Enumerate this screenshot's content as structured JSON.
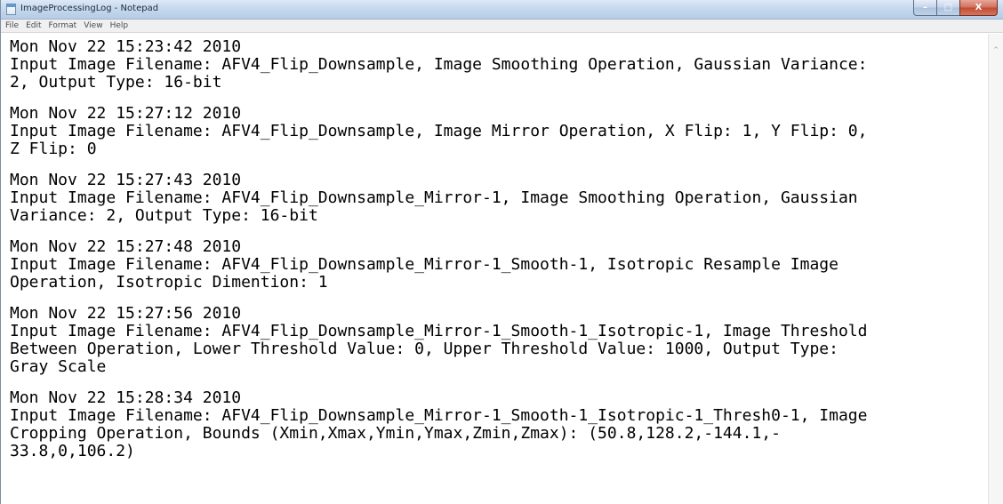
{
  "window": {
    "title": "ImageProcessingLog - Notepad",
    "controls": {
      "minimize_glyph": "–",
      "maximize_glyph": "□",
      "close_glyph": "X"
    }
  },
  "menubar": {
    "items": [
      {
        "label": "File"
      },
      {
        "label": "Edit"
      },
      {
        "label": "Format"
      },
      {
        "label": "View"
      },
      {
        "label": "Help"
      }
    ]
  },
  "scrollbar": {
    "up_arrow": "^"
  },
  "log_entries": [
    {
      "timestamp": "Mon Nov 22 15:23:42 2010",
      "lines": [
        "Input Image Filename: AFV4_Flip_Downsample, Image Smoothing Operation, Gaussian Variance:",
        "2, Output Type: 16-bit"
      ]
    },
    {
      "timestamp": "Mon Nov 22 15:27:12 2010",
      "lines": [
        "Input Image Filename: AFV4_Flip_Downsample, Image Mirror Operation, X Flip: 1, Y Flip: 0,",
        "Z Flip: 0"
      ]
    },
    {
      "timestamp": "Mon Nov 22 15:27:43 2010",
      "lines": [
        "Input Image Filename: AFV4_Flip_Downsample_Mirror-1, Image Smoothing Operation, Gaussian",
        "Variance: 2, Output Type: 16-bit"
      ]
    },
    {
      "timestamp": "Mon Nov 22 15:27:48 2010",
      "lines": [
        "Input Image Filename: AFV4_Flip_Downsample_Mirror-1_Smooth-1, Isotropic Resample Image",
        "Operation, Isotropic Dimention: 1"
      ]
    },
    {
      "timestamp": "Mon Nov 22 15:27:56 2010",
      "lines": [
        "Input Image Filename: AFV4_Flip_Downsample_Mirror-1_Smooth-1_Isotropic-1, Image Threshold",
        "Between Operation, Lower Threshold Value: 0, Upper Threshold Value: 1000, Output Type:",
        "Gray Scale"
      ]
    },
    {
      "timestamp": "Mon Nov 22 15:28:34 2010",
      "lines": [
        "Input Image Filename: AFV4_Flip_Downsample_Mirror-1_Smooth-1_Isotropic-1_Thresh0-1, Image",
        "Cropping Operation, Bounds (Xmin,Xmax,Ymin,Ymax,Zmin,Zmax): (50.8,128.2,-144.1,-",
        "33.8,0,106.2)"
      ]
    }
  ]
}
